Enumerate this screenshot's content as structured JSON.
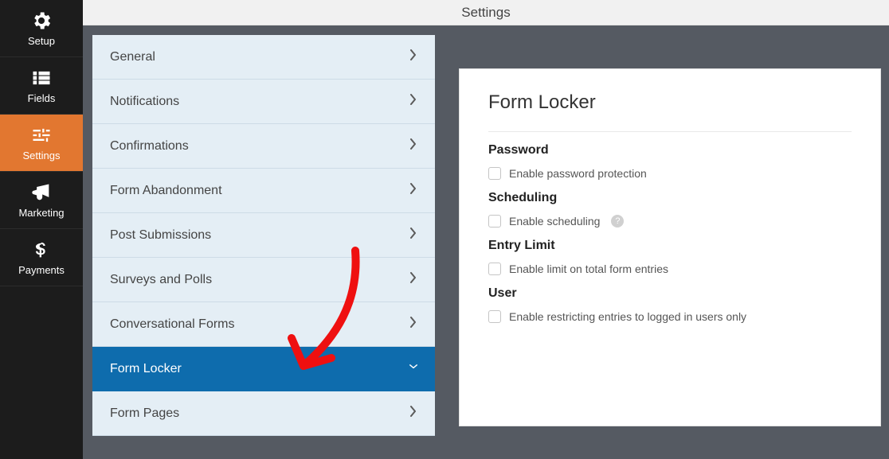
{
  "header": {
    "title": "Settings"
  },
  "leftnav": {
    "items": [
      {
        "id": "setup",
        "icon": "setup-icon",
        "label": "Setup",
        "active": false
      },
      {
        "id": "fields",
        "icon": "fields-icon",
        "label": "Fields",
        "active": false
      },
      {
        "id": "settings",
        "icon": "settings-icon",
        "label": "Settings",
        "active": true
      },
      {
        "id": "marketing",
        "icon": "marketing-icon",
        "label": "Marketing",
        "active": false
      },
      {
        "id": "payments",
        "icon": "payments-icon",
        "label": "Payments",
        "active": false
      }
    ]
  },
  "settings_list": {
    "items": [
      {
        "id": "general",
        "label": "General",
        "active": false
      },
      {
        "id": "notifications",
        "label": "Notifications",
        "active": false
      },
      {
        "id": "confirmations",
        "label": "Confirmations",
        "active": false
      },
      {
        "id": "form-abandonment",
        "label": "Form Abandonment",
        "active": false
      },
      {
        "id": "post-submissions",
        "label": "Post Submissions",
        "active": false
      },
      {
        "id": "surveys-and-polls",
        "label": "Surveys and Polls",
        "active": false
      },
      {
        "id": "conversational-forms",
        "label": "Conversational Forms",
        "active": false
      },
      {
        "id": "form-locker",
        "label": "Form Locker",
        "active": true
      },
      {
        "id": "form-pages",
        "label": "Form Pages",
        "active": false
      }
    ]
  },
  "card": {
    "title": "Form Locker",
    "sections": {
      "password": {
        "heading": "Password",
        "checkbox_label": "Enable password protection"
      },
      "scheduling": {
        "heading": "Scheduling",
        "checkbox_label": "Enable scheduling",
        "help": "?"
      },
      "entrylimit": {
        "heading": "Entry Limit",
        "checkbox_label": "Enable limit on total form entries"
      },
      "user": {
        "heading": "User",
        "checkbox_label": "Enable restricting entries to logged in users only"
      }
    }
  },
  "annotation": {
    "type": "red-arrow",
    "points_to": "form-locker"
  }
}
